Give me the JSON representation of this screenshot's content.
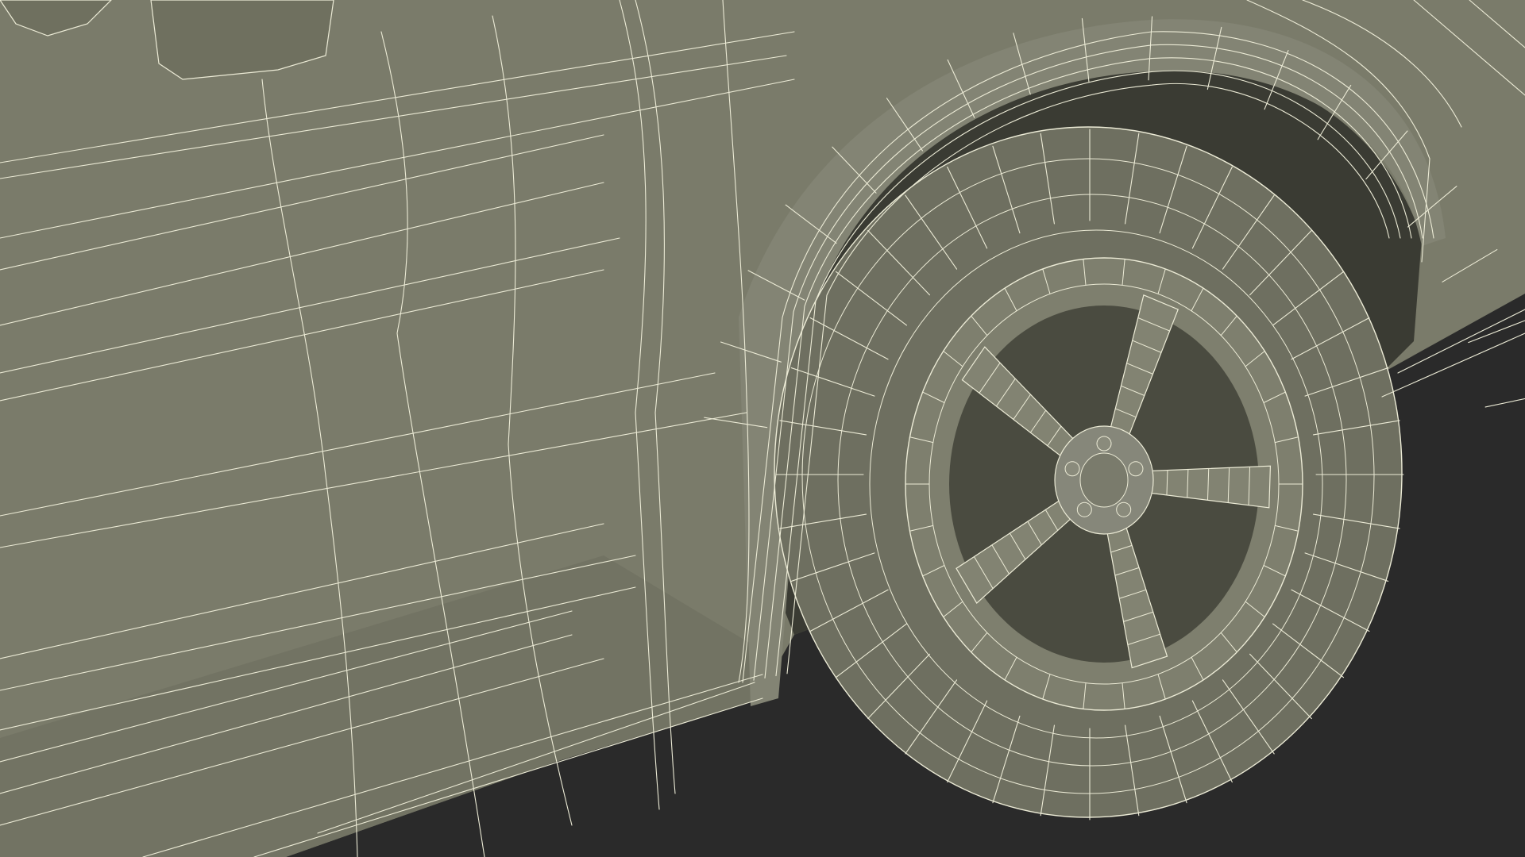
{
  "scene": {
    "subject": "wireframe-car-front-wheel",
    "colors": {
      "background": "#2a2a2a",
      "body": "#7a7b6a",
      "body_dark": "#5a5b4c",
      "body_shadow": "#3f4036",
      "wheel_well": "#3a3b33",
      "tire": "#6e6f60",
      "rim": "#7e7f6e",
      "wire": "#ecebd6"
    }
  }
}
